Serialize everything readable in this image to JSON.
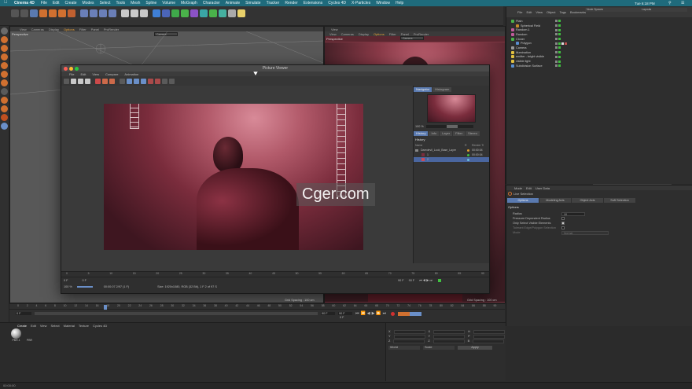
{
  "menubar": {
    "app": "Cinema 4D",
    "items": [
      "File",
      "Edit",
      "Create",
      "Modes",
      "Select",
      "Tools",
      "Mesh",
      "Spline",
      "Volume",
      "MoGraph",
      "Character",
      "Animate",
      "Simulate",
      "Tracker",
      "Render",
      "Extensions",
      "Cycles 4D",
      "X-Particles",
      "Window",
      "Help"
    ],
    "clock": "Tue 6:18 PM"
  },
  "doc_title": "Daredevil.c4d - Main",
  "layout_label": "Node Spaces",
  "layouts_label": "Layouts",
  "viewport_left": {
    "menu": [
      "View",
      "Cameras",
      "Display",
      "Options",
      "Filter",
      "Panel",
      "ProRender"
    ],
    "label": "Perspective",
    "camera": "Camera"
  },
  "viewport_right": {
    "title": "View",
    "menu": [
      "View",
      "Cameras",
      "Display",
      "Options",
      "Filter",
      "Panel",
      "ProRender"
    ],
    "label": "Perspective",
    "camera": "Camera"
  },
  "picture_viewer": {
    "title": "Picture Viewer",
    "menu": [
      "File",
      "Edit",
      "View",
      "Compare",
      "Animation"
    ],
    "side_tabs": [
      "Navigator",
      "Histogram"
    ],
    "zoom": "100 %",
    "info_tabs": [
      "History",
      "Info",
      "Layer",
      "Filter",
      "Stereo"
    ],
    "history_header": "History",
    "history_cols": {
      "name": "Name",
      "r": "R",
      "render": "Render Ti"
    },
    "history_rows": [
      {
        "name": "Daredevil_Look_Base_Layer",
        "time": "00:00:04"
      },
      {
        "name": "1",
        "time": "00:00:04"
      },
      {
        "name": "2",
        "time": ""
      }
    ],
    "ruler": [
      "0",
      "5",
      "10",
      "15",
      "20",
      "25",
      "30",
      "35",
      "40",
      "45",
      "50",
      "55",
      "60",
      "65",
      "70",
      "75",
      "80",
      "85",
      "90"
    ],
    "frame_start": "0 F",
    "frame_cur": "0 F",
    "frame_end": "90 F",
    "fps": "90 F",
    "zoom_bottom": "100 %",
    "time_code": "00:00:07  2/97 (1 F)",
    "size_info": "Size: 1920x1080, RGB (32 Bit), 1 F  2 of 97 S"
  },
  "watermark": "Cger.com",
  "object_manager": {
    "menu": [
      "File",
      "Edit",
      "View",
      "Object",
      "Tags",
      "Bookmarks"
    ],
    "objects": [
      {
        "name": "Plain",
        "color": "#4ab24a",
        "depth": 0
      },
      {
        "name": "Spherical Field",
        "color": "#c58a2a",
        "depth": 1
      },
      {
        "name": "Random.1",
        "color": "#c05a9a",
        "depth": 0
      },
      {
        "name": "Random",
        "color": "#c05a9a",
        "depth": 0
      },
      {
        "name": "Cloner",
        "color": "#4ab24a",
        "depth": 0
      },
      {
        "name": "Polygon",
        "color": "#5a8fd0",
        "depth": 1
      },
      {
        "name": "Camera",
        "color": "#9b9b9b",
        "depth": 0
      },
      {
        "name": "illumination",
        "color": "#e0c040",
        "depth": 0
      },
      {
        "name": "emitter - bright visible",
        "color": "#e0c040",
        "depth": 0
      },
      {
        "name": "visible light",
        "color": "#e0c040",
        "depth": 0
      },
      {
        "name": "Subdivision Surface",
        "color": "#5a8fd0",
        "depth": 0
      }
    ]
  },
  "attribute_manager": {
    "menu": [
      "Mode",
      "Edit",
      "User Data"
    ],
    "tool": "Live Selection",
    "tabs": [
      "Options",
      "Modeling Axis",
      "Object Axis",
      "Soft Selection"
    ],
    "section": "Options",
    "radius_label": "Radius",
    "radius_value": "10",
    "pressure_label": "Pressure Dependent Radius",
    "only_visible_label": "Only Select Visible Elements",
    "tolerant_label": "Tolerant Edge/Polygon Selection",
    "mode_label": "Mode",
    "mode_value": "Normal"
  },
  "timeline": {
    "ruler": [
      "0",
      "2",
      "4",
      "6",
      "8",
      "10",
      "12",
      "14",
      "16",
      "18",
      "20",
      "22",
      "24",
      "26",
      "28",
      "30",
      "32",
      "34",
      "36",
      "38",
      "40",
      "42",
      "44",
      "46",
      "48",
      "50",
      "52",
      "54",
      "56",
      "58",
      "60",
      "62",
      "64",
      "66",
      "68",
      "70",
      "72",
      "74",
      "76",
      "78",
      "80",
      "82",
      "84",
      "86",
      "88",
      "90"
    ],
    "start": "0 F",
    "end": "90 F",
    "end2": "90 F",
    "cur": "0 F",
    "grid_spacing": "Grid Spacing : 100 cm",
    "grid_spacing_right": "Grid Spacing : 100 cm"
  },
  "material_manager": {
    "menu": [
      "Create",
      "Edit",
      "View",
      "Select",
      "Material",
      "Texture",
      "Cycles 4D"
    ],
    "materials": [
      "PBR.1",
      "PBR"
    ]
  },
  "coords": {
    "rows": [
      {
        "a": "X",
        "b": "X",
        "c": "H"
      },
      {
        "a": "Y",
        "b": "Y",
        "c": "P"
      },
      {
        "a": "Z",
        "b": "Z",
        "c": "B"
      }
    ],
    "world": "World",
    "scale": "Scale",
    "apply": "Apply"
  },
  "status": "00:00:00"
}
